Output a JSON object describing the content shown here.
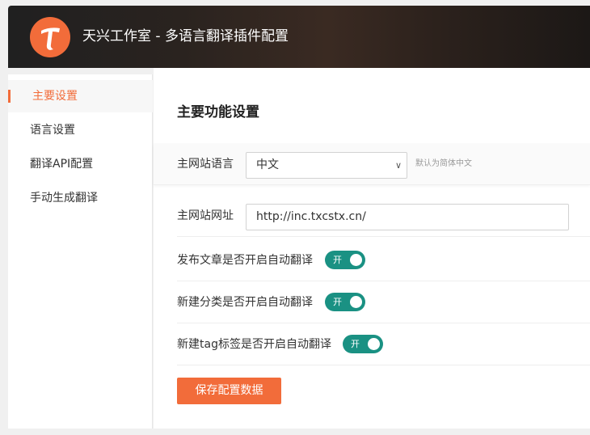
{
  "header": {
    "title": "天兴工作室 - 多语言翻译插件配置",
    "logo_icon": "orange-t-logo-icon"
  },
  "sidebar": {
    "items": [
      {
        "label": "主要设置",
        "active": true
      },
      {
        "label": "语言设置",
        "active": false
      },
      {
        "label": "翻译API配置",
        "active": false
      },
      {
        "label": "手动生成翻译",
        "active": false
      }
    ]
  },
  "main": {
    "section_title": "主要功能设置",
    "site_language": {
      "label": "主网站语言",
      "selected": "中文",
      "hint": "默认为简体中文"
    },
    "site_url": {
      "label": "主网站网址",
      "value": "http://inc.txcstx.cn/"
    },
    "toggles": [
      {
        "label": "发布文章是否开启自动翻译",
        "state_label": "开",
        "on": true
      },
      {
        "label": "新建分类是否开启自动翻译",
        "state_label": "开",
        "on": true
      },
      {
        "label": "新建tag标签是否开启自动翻译",
        "state_label": "开",
        "on": true
      }
    ],
    "save_label": "保存配置数据"
  },
  "colors": {
    "accent": "#f26c3a",
    "toggle_on": "#1a9183",
    "header_bg": "#231e1b"
  }
}
